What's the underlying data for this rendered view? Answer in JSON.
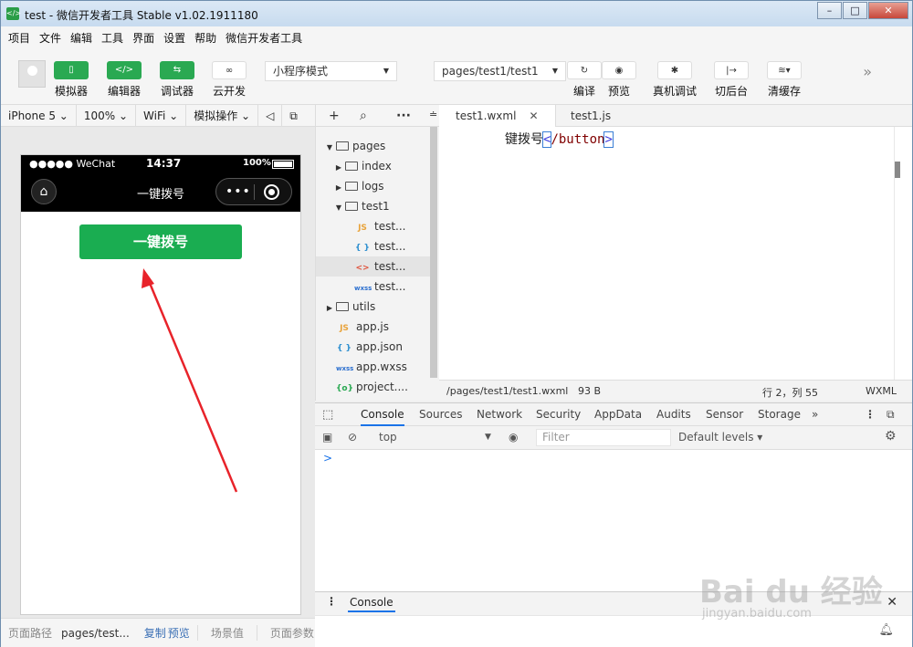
{
  "window": {
    "title": "test - 微信开发者工具 Stable v1.02.1911180",
    "icon": "</>"
  },
  "menu": [
    "项目",
    "文件",
    "编辑",
    "工具",
    "界面",
    "设置",
    "帮助",
    "微信开发者工具"
  ],
  "toolbar": {
    "simulator": "模拟器",
    "editor": "编辑器",
    "debugger": "调试器",
    "cloud": "云开发",
    "mode": "小程序模式",
    "path": "pages/test1/test1",
    "compile": "编译",
    "preview": "预览",
    "real_debug": "真机调试",
    "background": "切后台",
    "clear_cache": "清缓存"
  },
  "sim_bar": {
    "device": "iPhone 5 ⌄",
    "zoom": "100% ⌄",
    "network": "WiFi ⌄",
    "operation": "模拟操作 ⌄"
  },
  "phone": {
    "carrier": "●●●●● WeChat",
    "time": "14:37",
    "battery": "100%",
    "nav_title": "一键拨号",
    "button_label": "一键拨号"
  },
  "sim_footer": {
    "path_label": "页面路径",
    "path_value": "pages/test...",
    "copy": "复制",
    "preview": "预览",
    "scene": "场景值",
    "params": "页面参数"
  },
  "tree": [
    {
      "label": "pages",
      "type": "folder-open"
    },
    {
      "label": "index",
      "type": "folder"
    },
    {
      "label": "logs",
      "type": "folder"
    },
    {
      "label": "test1",
      "type": "folder-open"
    },
    {
      "label": "test...",
      "type": "js"
    },
    {
      "label": "test...",
      "type": "json"
    },
    {
      "label": "test...",
      "type": "wxml"
    },
    {
      "label": "test...",
      "type": "wxss"
    },
    {
      "label": "utils",
      "type": "folder"
    },
    {
      "label": "app.js",
      "type": "js"
    },
    {
      "label": "app.json",
      "type": "json"
    },
    {
      "label": "app.wxss",
      "type": "wxss"
    },
    {
      "label": "project....",
      "type": "config"
    }
  ],
  "editor": {
    "tab_active": "test1.wxml",
    "tab_other": "test1.js",
    "code_text": "键拨号",
    "code_tag_open": "<",
    "code_tag_name": "/button",
    "code_tag_close": ">",
    "status_path": "/pages/test1/test1.wxml",
    "status_size": "93 B",
    "status_pos": "行 2，列 55",
    "status_lang": "WXML"
  },
  "devtools": {
    "tabs": [
      "Console",
      "Sources",
      "Network",
      "Security",
      "AppData",
      "Audits",
      "Sensor",
      "Storage"
    ],
    "more": "»",
    "context": "top",
    "filter_placeholder": "Filter",
    "levels": "Default levels ▾",
    "prompt": ">",
    "drawer_tab": "Console"
  },
  "watermark": {
    "brand": "Bai du 经验",
    "url": "jingyan.baidu.com"
  }
}
